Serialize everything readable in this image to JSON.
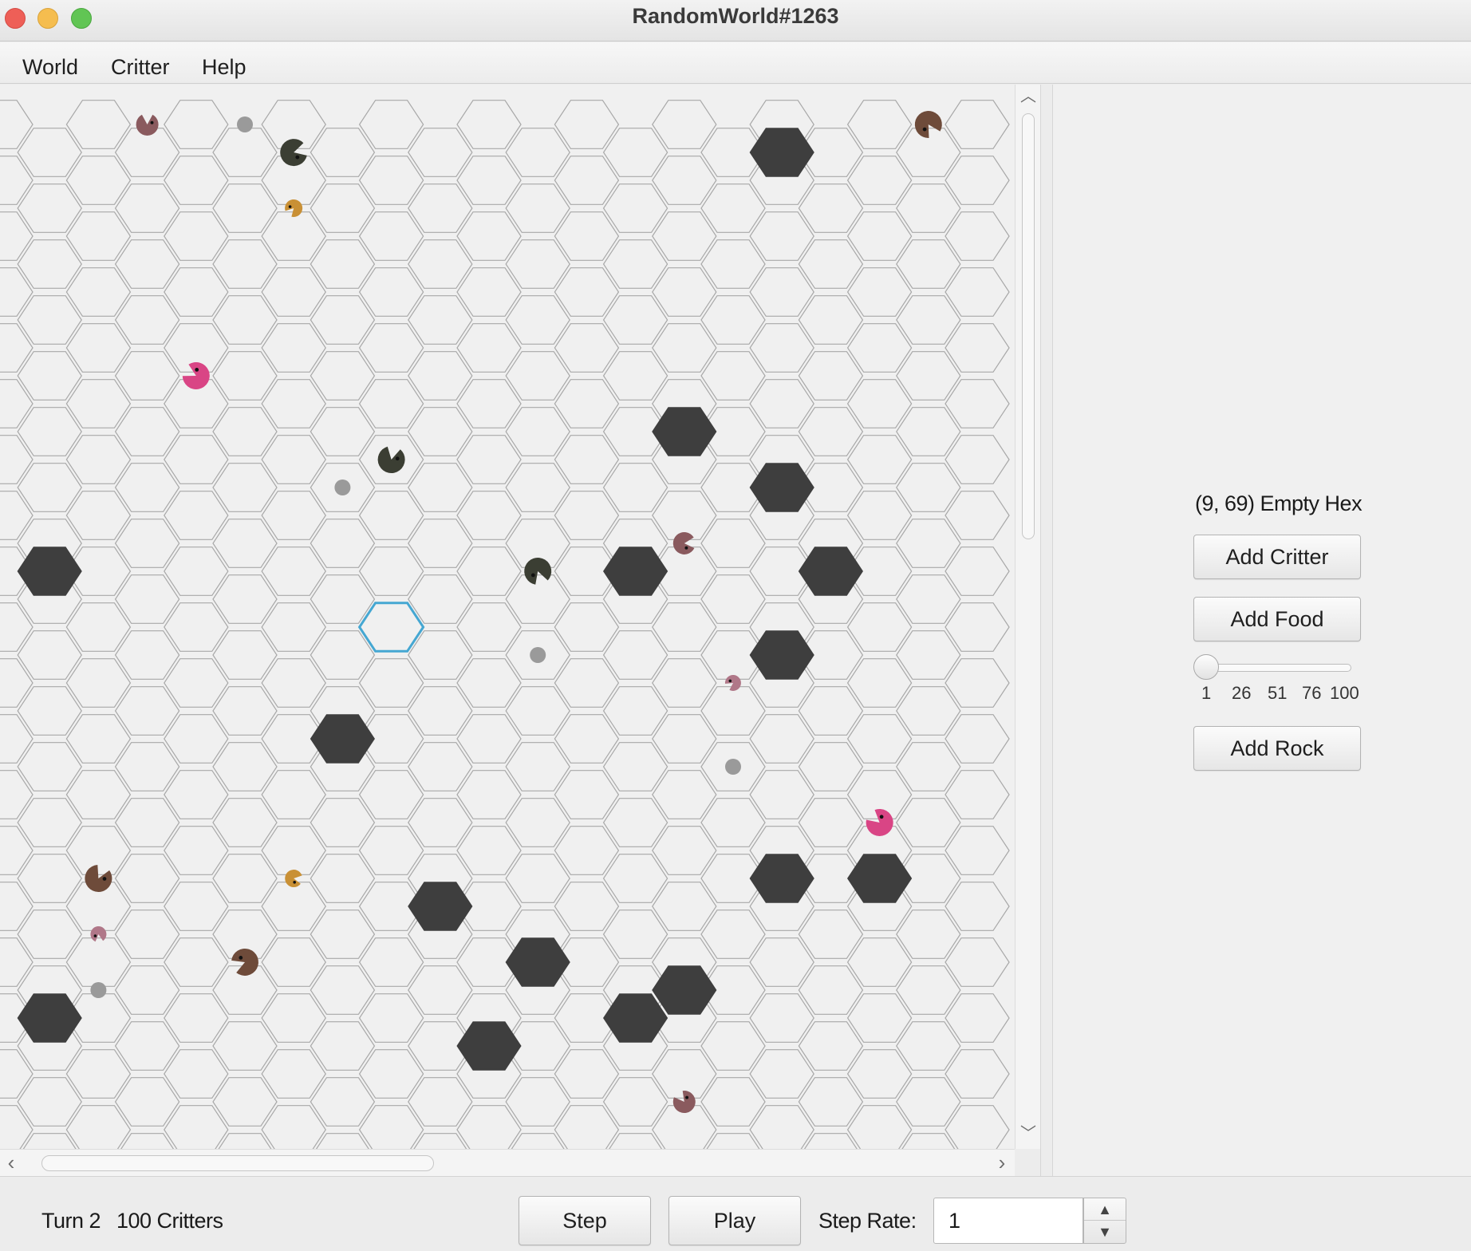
{
  "window": {
    "title": "RandomWorld#1263"
  },
  "menu": {
    "items": [
      "World",
      "Critter",
      "Help"
    ]
  },
  "side_panel": {
    "hex_info": "(9, 69) Empty Hex",
    "add_critter_label": "Add Critter",
    "add_food_label": "Add Food",
    "food_slider": {
      "value": 1,
      "min": 1,
      "max": 100,
      "ticks": [
        "1",
        "26",
        "51",
        "76",
        "100"
      ]
    },
    "add_rock_label": "Add Rock"
  },
  "status": {
    "turn": "Turn 2",
    "critters": "100 Critters",
    "step_label": "Step",
    "play_label": "Play",
    "step_rate_label": "Step Rate:",
    "step_rate_value": "1"
  },
  "world": {
    "visible_grid": {
      "columns": 21,
      "rows": 38
    },
    "selected_hex": {
      "col": 8,
      "row": 18
    },
    "rocks": [
      {
        "col": 16,
        "row": 1
      },
      {
        "col": 14,
        "row": 11
      },
      {
        "col": 16,
        "row": 13
      },
      {
        "col": 1,
        "row": 16
      },
      {
        "col": 13,
        "row": 16
      },
      {
        "col": 17,
        "row": 16
      },
      {
        "col": 16,
        "row": 19
      },
      {
        "col": 7,
        "row": 22
      },
      {
        "col": 16,
        "row": 27
      },
      {
        "col": 18,
        "row": 27
      },
      {
        "col": 9,
        "row": 28
      },
      {
        "col": 11,
        "row": 30
      },
      {
        "col": 14,
        "row": 31
      },
      {
        "col": 1,
        "row": 32
      },
      {
        "col": 13,
        "row": 32
      },
      {
        "col": 10,
        "row": 33
      }
    ],
    "food": [
      {
        "col": 5,
        "row": 0
      },
      {
        "col": 7,
        "row": 13
      },
      {
        "col": 11,
        "row": 19
      },
      {
        "col": 15,
        "row": 23
      },
      {
        "col": 2,
        "row": 31
      }
    ],
    "critters": [
      {
        "col": 3,
        "row": 0,
        "color": "#8a5a5e",
        "size": 14
      },
      {
        "col": 6,
        "row": 1,
        "color": "#3b3e33",
        "size": 17
      },
      {
        "col": 19,
        "row": 0,
        "color": "#6e4b3a",
        "size": 17
      },
      {
        "col": 6,
        "row": 3,
        "color": "#c99035",
        "size": 11
      },
      {
        "col": 4,
        "row": 9,
        "color": "#d94585",
        "size": 17
      },
      {
        "col": 8,
        "row": 12,
        "color": "#3b3e33",
        "size": 17
      },
      {
        "col": 14,
        "row": 15,
        "color": "#8a5a5e",
        "size": 14
      },
      {
        "col": 11,
        "row": 16,
        "color": "#3b3e33",
        "size": 17
      },
      {
        "col": 15,
        "row": 20,
        "color": "#b07788",
        "size": 10
      },
      {
        "col": 18,
        "row": 25,
        "color": "#d94585",
        "size": 17
      },
      {
        "col": 2,
        "row": 27,
        "color": "#6e4b3a",
        "size": 17
      },
      {
        "col": 6,
        "row": 27,
        "color": "#c99035",
        "size": 11
      },
      {
        "col": 2,
        "row": 29,
        "color": "#b07788",
        "size": 10
      },
      {
        "col": 5,
        "row": 30,
        "color": "#6e4b3a",
        "size": 17
      },
      {
        "col": 14,
        "row": 35,
        "color": "#8a5a5e",
        "size": 14
      }
    ]
  },
  "colors": {
    "rock": "#3e3e3e",
    "food": "#9a9a9a",
    "hex_line": "#a8a8a8",
    "selection": "#45a7d2",
    "world_bg": "#f0f0f0"
  }
}
